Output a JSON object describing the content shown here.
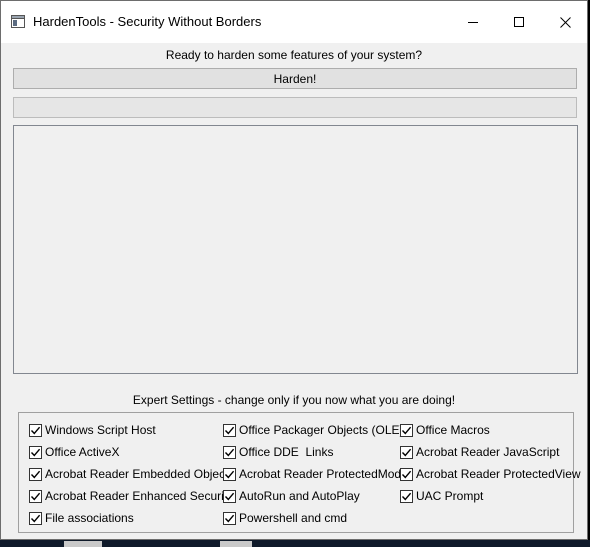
{
  "window": {
    "title": "HardenTools - Security Without Borders"
  },
  "main": {
    "status_text": "Ready to harden some features of your system?",
    "harden_button_label": "Harden!",
    "progress_value": 0,
    "log_text": ""
  },
  "expert": {
    "label": "Expert Settings - change only if you now what you are doing!",
    "checkboxes": [
      {
        "label": "Windows Script Host",
        "checked": true
      },
      {
        "label": "Office Packager Objects (OLE)",
        "checked": true
      },
      {
        "label": "Office Macros",
        "checked": true
      },
      {
        "label": "Office ActiveX",
        "checked": true
      },
      {
        "label": "Office DDE  Links",
        "checked": true
      },
      {
        "label": "Acrobat Reader JavaScript",
        "checked": true
      },
      {
        "label": "Acrobat Reader Embedded Objects",
        "checked": true
      },
      {
        "label": "Acrobat Reader ProtectedMode",
        "checked": true
      },
      {
        "label": "Acrobat Reader ProtectedView",
        "checked": true
      },
      {
        "label": "Acrobat Reader Enhanced Security",
        "checked": true
      },
      {
        "label": "AutoRun and AutoPlay",
        "checked": true
      },
      {
        "label": "UAC Prompt",
        "checked": true
      },
      {
        "label": "File associations",
        "checked": true
      },
      {
        "label": "Powershell and cmd",
        "checked": true
      }
    ]
  },
  "colors": {
    "window_bg": "#f0f0f0",
    "titlebar_bg": "#ffffff",
    "button_bg": "#e1e1e1",
    "progress_fill": "#06b025"
  }
}
